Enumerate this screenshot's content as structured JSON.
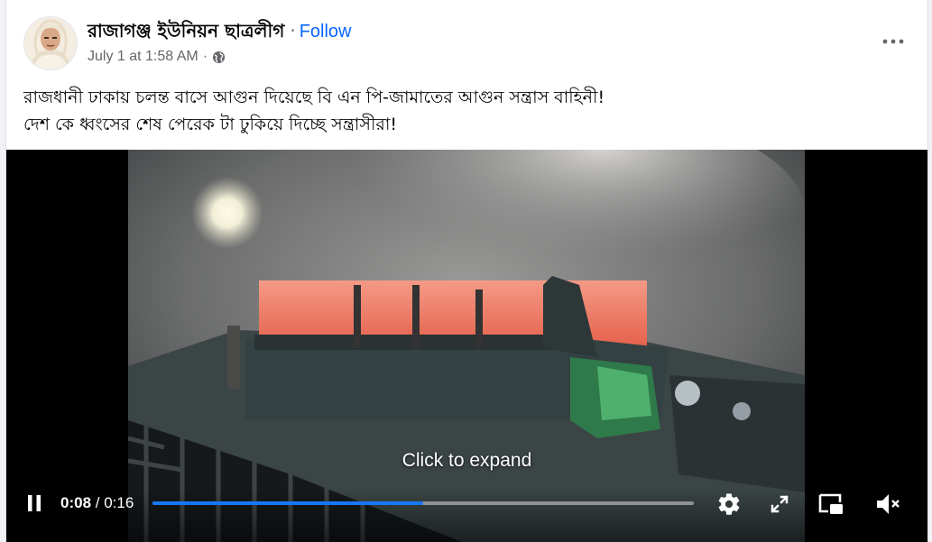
{
  "post": {
    "page_name": "রাজাগঞ্জ ইউনিয়ন ছাত্রলীগ",
    "separator": "·",
    "follow_label": "Follow",
    "timestamp": "July 1 at 1:58 AM",
    "meta_separator": "·",
    "privacy_icon": "globe-icon",
    "more_icon": "more-options-icon",
    "text_lines": [
      "রাজধানী ঢাকায় চলন্ত বাসে আগুন দিয়েছে বি এন পি-জামাতের আগুন সন্ত্রাস বাহিনী!",
      "দেশ কে ধ্বংসের শেষ পেরেক টা ঢুকিয়ে দিচ্ছে সন্ত্রাসীরা!"
    ]
  },
  "video": {
    "expand_hint": "Click to expand",
    "current_time": "0:08",
    "time_separator": " / ",
    "duration": "0:16",
    "progress_fraction": 0.5,
    "progress_color": "#1877f2",
    "icons": [
      "pause-icon",
      "settings-icon",
      "fullscreen-icon",
      "picture-in-picture-icon",
      "mute-icon"
    ]
  }
}
